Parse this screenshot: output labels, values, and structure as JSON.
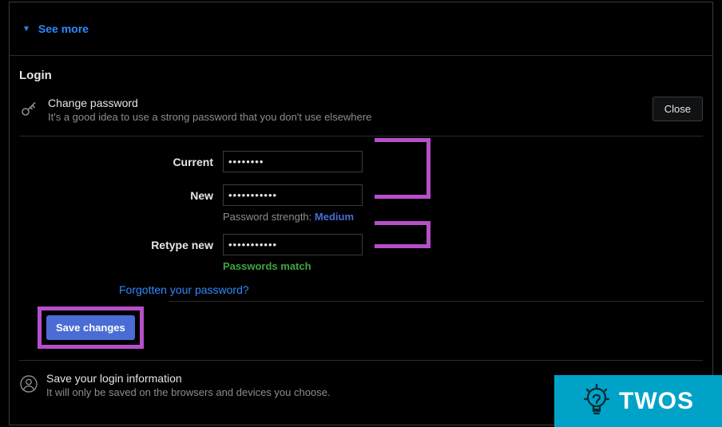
{
  "see_more": {
    "label": "See more"
  },
  "section": {
    "title": "Login",
    "change_password": {
      "title": "Change password",
      "subtitle": "It's a good idea to use a strong password that you don't use elsewhere",
      "close": "Close"
    },
    "form": {
      "current": {
        "label": "Current",
        "value": "••••••••"
      },
      "new": {
        "label": "New",
        "value": "•••••••••••"
      },
      "strength_label": "Password strength:",
      "strength_value": "Medium",
      "retype": {
        "label": "Retype new",
        "value": "•••••••••••"
      },
      "match": "Passwords match",
      "forgot": "Forgotten your password?",
      "save": "Save changes"
    },
    "save_login": {
      "title": "Save your login information",
      "subtitle": "It will only be saved on the browsers and devices you choose."
    }
  },
  "watermark": {
    "text": "TWOS"
  },
  "colors": {
    "link": "#2e89ff",
    "highlight": "#b64fc8",
    "strength": "#4a6cd4",
    "match": "#3fa63f",
    "watermark_bg": "#00a3c7"
  }
}
